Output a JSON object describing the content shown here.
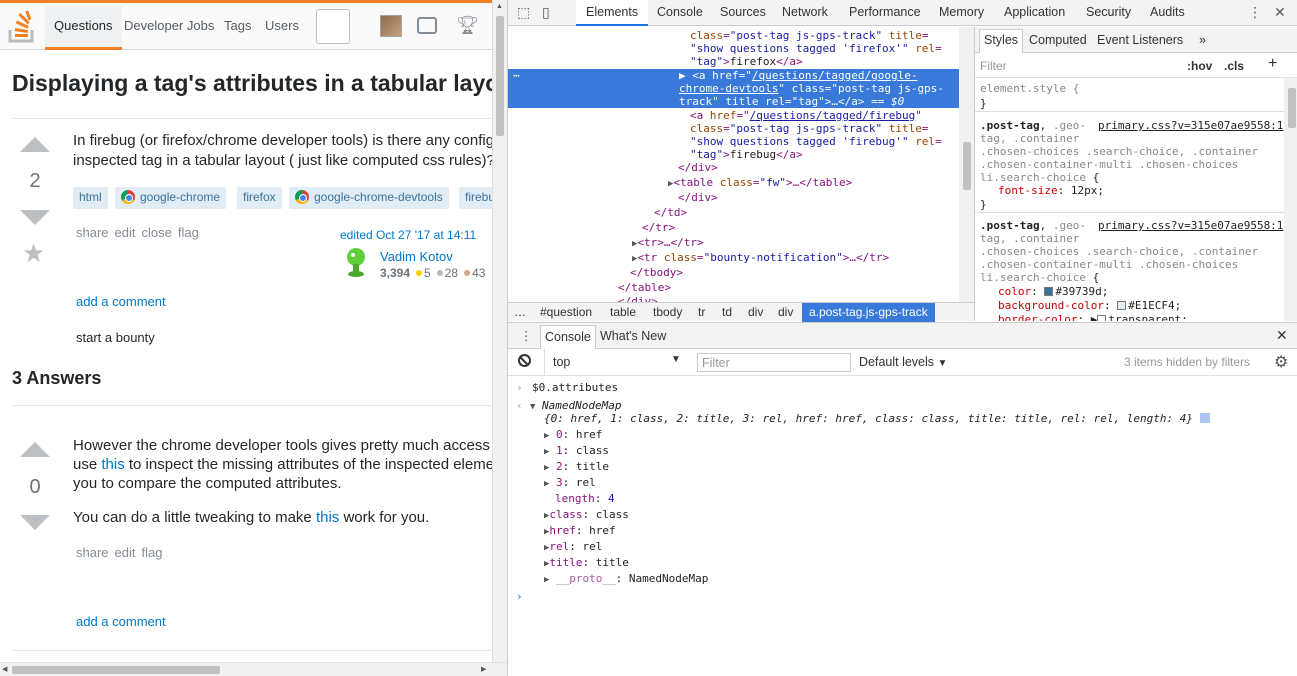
{
  "page": {
    "nav": {
      "questions": "Questions",
      "jobs": "Developer Jobs",
      "tags": "Tags",
      "users": "Users"
    },
    "question": {
      "title": "Displaying a tag's attributes in a tabular layout",
      "votes": "2",
      "body_line1": "In firebug (or firefox/chrome developer tools) is there any config",
      "body_line2": "inspected tag in a tabular layout ( just like computed css rules)?",
      "tags": [
        "html",
        "google-chrome",
        "firefox",
        "google-chrome-devtools",
        "firebug"
      ],
      "menu": [
        "share",
        "edit",
        "close",
        "flag"
      ],
      "edited": "edited Oct 27 '17 at 14:11",
      "user_name": "Vadim Kotov",
      "user_rep": "3,394",
      "badge_gold": "5",
      "badge_silver": "28",
      "badge_bronze": "43",
      "add_comment": "add a comment",
      "start_bounty": "start a bounty"
    },
    "answers_header": "3 Answers",
    "answer": {
      "votes": "0",
      "line1": "However the chrome developer tools gives pretty much access",
      "line2_pre": "use ",
      "line2_link": "this",
      "line2_post": " to inspect the missing attributes of the inspected eleme",
      "line3": "you to compare the computed attributes.",
      "line4_pre": "You can do a little tweaking to make ",
      "line4_link": "this",
      "line4_post": " work for you.",
      "menu": [
        "share",
        "edit",
        "flag"
      ],
      "add_comment": "add a comment"
    }
  },
  "devtools": {
    "tabs": [
      "Elements",
      "Console",
      "Sources",
      "Network",
      "Performance",
      "Memory",
      "Application",
      "Security",
      "Audits"
    ],
    "active_tab": "Elements",
    "dom": {
      "l0_class": "post-tag js-gps-track",
      "l0_title": "show questions tagged 'firefox'",
      "l0_rel": "tag",
      "l0_text": "firefox",
      "sel_href": "/questions/tagged/google-",
      "sel_href2": "chrome-devtools",
      "sel_class": "post-tag js-gps-",
      "sel_class2": "track",
      "sel_suffix": "== $0",
      "l3_href": "/questions/tagged/firebug",
      "l3_class": "post-tag js-gps-track",
      "l3_title": "show questions tagged 'firebug'",
      "l3_rel": "tag",
      "l3_text": "firebug",
      "table_class": "fw",
      "tr_class": "bounty-notification"
    },
    "breadcrumbs": [
      "…",
      "#question",
      "table",
      "tbody",
      "tr",
      "td",
      "div",
      "div",
      "a.post-tag.js-gps-track"
    ],
    "styles": {
      "tabs": [
        "Styles",
        "Computed",
        "Event Listeners"
      ],
      "filter_placeholder": "Filter",
      "hov": ":hov",
      "cls": ".cls",
      "element_style": "element.style {",
      "rule1_source": "primary.css?v=315e07ae9558:1",
      "rule1_prop": "font-size",
      "rule1_val": "12px",
      "rule2_source": "primary.css?v=315e07ae9558:1",
      "rule2_color": "#39739d",
      "rule2_bg": "#E1ECF4",
      "rule2_border": "transparent",
      "swatch_color": "#39739d",
      "swatch_bg": "#E1ECF4"
    },
    "console": {
      "drawer_tabs": [
        "Console",
        "What's New"
      ],
      "context": "top",
      "filter_placeholder": "Filter",
      "levels": "Default levels",
      "hidden": "3 items hidden by filters",
      "input": "$0.attributes",
      "map_name": "NamedNodeMap",
      "map_summary": "{0: href, 1: class, 2: title, 3: rel, href: href, class: class, title: title, rel: rel, length: 4}",
      "entries": [
        {
          "k": "0",
          "v": "href"
        },
        {
          "k": "1",
          "v": "class"
        },
        {
          "k": "2",
          "v": "title"
        },
        {
          "k": "3",
          "v": "rel"
        }
      ],
      "length": "4",
      "named": [
        {
          "k": "class",
          "v": "class"
        },
        {
          "k": "href",
          "v": "href"
        },
        {
          "k": "rel",
          "v": "rel"
        },
        {
          "k": "title",
          "v": "title"
        },
        {
          "k": "__proto__",
          "v": "NamedNodeMap"
        }
      ]
    }
  }
}
